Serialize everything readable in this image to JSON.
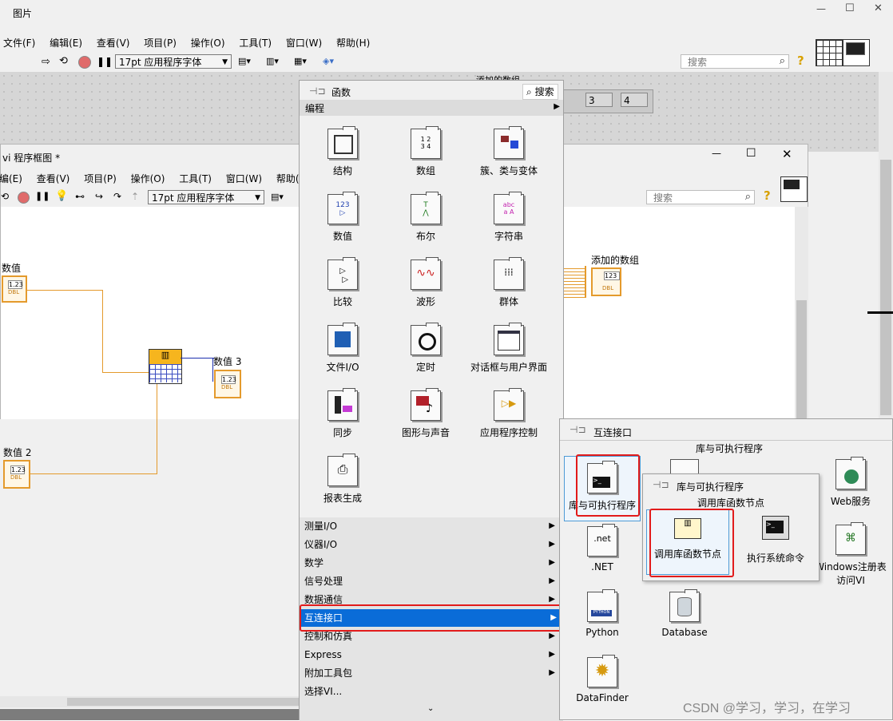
{
  "front_window": {
    "title": "图片",
    "menu": [
      "文件(F)",
      "编辑(E)",
      "查看(V)",
      "项目(P)",
      "操作(O)",
      "工具(T)",
      "窗口(W)",
      "帮助(H)"
    ],
    "font_select": "17pt 应用程序字体",
    "search_placeholder": "搜索",
    "array_label": "添加的数组",
    "array_values": [
      "3",
      "4"
    ]
  },
  "block_window": {
    "title": "vi 程序框图 *",
    "menu": [
      "编(E)",
      "查看(V)",
      "项目(P)",
      "操作(O)",
      "工具(T)",
      "窗口(W)",
      "帮助(H)"
    ],
    "font_select": "17pt 应用程序字体",
    "search_placeholder": "搜索",
    "labels": {
      "num1": "数值",
      "num2": "数值 2",
      "num3": "数值 3",
      "added_array": "添加的数组",
      "dbl": "DBL",
      "val": "1.23",
      "val123": "123"
    }
  },
  "functions_palette": {
    "title": "函数",
    "search_label": "搜索",
    "section": "编程",
    "items": [
      "结构",
      "数组",
      "簇、类与变体",
      "数值",
      "布尔",
      "字符串",
      "比较",
      "波形",
      "群体",
      "文件I/O",
      "定时",
      "对话框与用户界面",
      "同步",
      "图形与声音",
      "应用程序控制",
      "报表生成"
    ],
    "categories": [
      "测量I/O",
      "仪器I/O",
      "数学",
      "信号处理",
      "数据通信",
      "互连接口",
      "控制和仿真",
      "Express",
      "附加工具包",
      "选择VI..."
    ],
    "selected_category": "互连接口"
  },
  "interconnect_palette": {
    "title": "互连接口",
    "hover_label": "库与可执行程序",
    "items": [
      "库与可执行程序",
      ".NET",
      "Python",
      "Database",
      "DataFinder",
      "Web服务",
      "Windows注册表访问VI"
    ]
  },
  "libexec_palette": {
    "title": "库与可执行程序",
    "hover_label": "调用库函数节点",
    "items": [
      "调用库函数节点",
      "执行系统命令"
    ]
  },
  "watermark": "CSDN @学习，学习，在学习",
  "window_controls": {
    "minimize": "—",
    "maximize": "☐",
    "close": "✕"
  }
}
